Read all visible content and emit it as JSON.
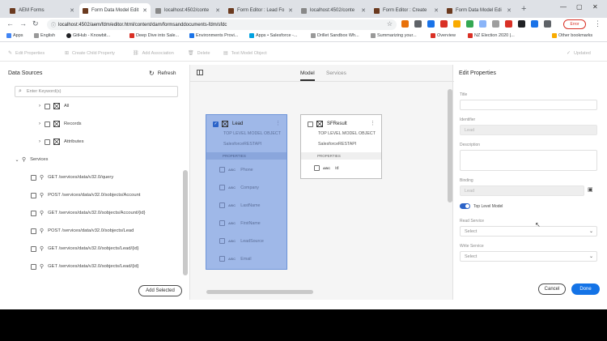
{
  "browser": {
    "tabs": [
      {
        "label": "AEM Forms"
      },
      {
        "label": "Form Data Model Edit"
      },
      {
        "label": "localhost:4502/conte"
      },
      {
        "label": "Form Editor : Lead Fo"
      },
      {
        "label": "localhost:4502/conte"
      },
      {
        "label": "Form Editor : Create"
      },
      {
        "label": "Form Data Model Edi"
      }
    ],
    "url": "localhost:4502/aem/fdm/editor.html/content/dam/formsanddocuments-fdm/sfdc",
    "profile_label": "Error",
    "bookmarks": [
      {
        "label": "Apps"
      },
      {
        "label": "English"
      },
      {
        "label": "GitHub - Knowbit..."
      },
      {
        "label": "Deep Dive into Sale..."
      },
      {
        "label": "Environments Provi..."
      },
      {
        "label": "Apps • Salesforce -..."
      },
      {
        "label": "Drillet Sandbox Wh..."
      },
      {
        "label": "Summarizing your..."
      },
      {
        "label": "Overview"
      },
      {
        "label": "NZ Election 2020 |..."
      },
      {
        "label": "Other bookmarks"
      }
    ]
  },
  "toolbar": {
    "items": [
      {
        "label": "Edit Properties"
      },
      {
        "label": "Create Child Property"
      },
      {
        "label": "Add Association"
      },
      {
        "label": "Delete"
      },
      {
        "label": "Test Model Object"
      }
    ],
    "updated_label": "Updated"
  },
  "left_panel": {
    "title": "Data Sources",
    "refresh_label": "Refresh",
    "search_placeholder": "Enter Keyword(s)",
    "tree": [
      {
        "label": "All"
      },
      {
        "label": "Records"
      },
      {
        "label": "Attributes"
      },
      {
        "label": "Services"
      },
      {
        "label": "GET /services/data/v32.0/query"
      },
      {
        "label": "POST /services/data/v32.0/sobjects/Account"
      },
      {
        "label": "GET /services/data/v32.0/sobjects/Account/{id}"
      },
      {
        "label": "POST /services/data/v32.0/sobjects/Lead"
      },
      {
        "label": "GET /services/data/v32.0/sobjects/Lead/{id}"
      },
      {
        "label": "GET /services/data/v32.0/sobjects/Lead/{id}"
      }
    ],
    "add_selected_label": "Add Selected"
  },
  "canvas": {
    "tabs": [
      {
        "label": "Model"
      },
      {
        "label": "Services"
      }
    ],
    "lead": {
      "title": "Lead",
      "subtitle": "TOP LEVEL MODEL OBJECT",
      "source": "SalesforceRESTAPI",
      "properties_label": "PROPERTIES",
      "abc": "ABC",
      "rows": [
        {
          "label": "Phone"
        },
        {
          "label": "Company"
        },
        {
          "label": "LastName"
        },
        {
          "label": "FirstName"
        },
        {
          "label": "LeadSource"
        },
        {
          "label": "Email"
        }
      ]
    },
    "sfresult": {
      "title": "SFResult",
      "subtitle": "TOP LEVEL MODEL OBJECT",
      "source": "SalesforceRESTAPI",
      "properties_label": "PROPERTIES",
      "abc": "ABC",
      "row": "id"
    }
  },
  "right_panel": {
    "title": "Edit Properties",
    "title_label": "Title",
    "identifier_label": "Identifier",
    "identifier_value": "Lead",
    "description_label": "Description",
    "binding_label": "Binding",
    "binding_value": "Lead",
    "top_level_label": "Top Level Model",
    "read_service_label": "Read Service",
    "read_service_value": "Select",
    "write_service_label": "Write Service",
    "write_service_value": "Select",
    "cancel_label": "Cancel",
    "done_label": "Done"
  },
  "colors": {
    "accent": "#1473e6",
    "selection": "#9fb8e8"
  }
}
